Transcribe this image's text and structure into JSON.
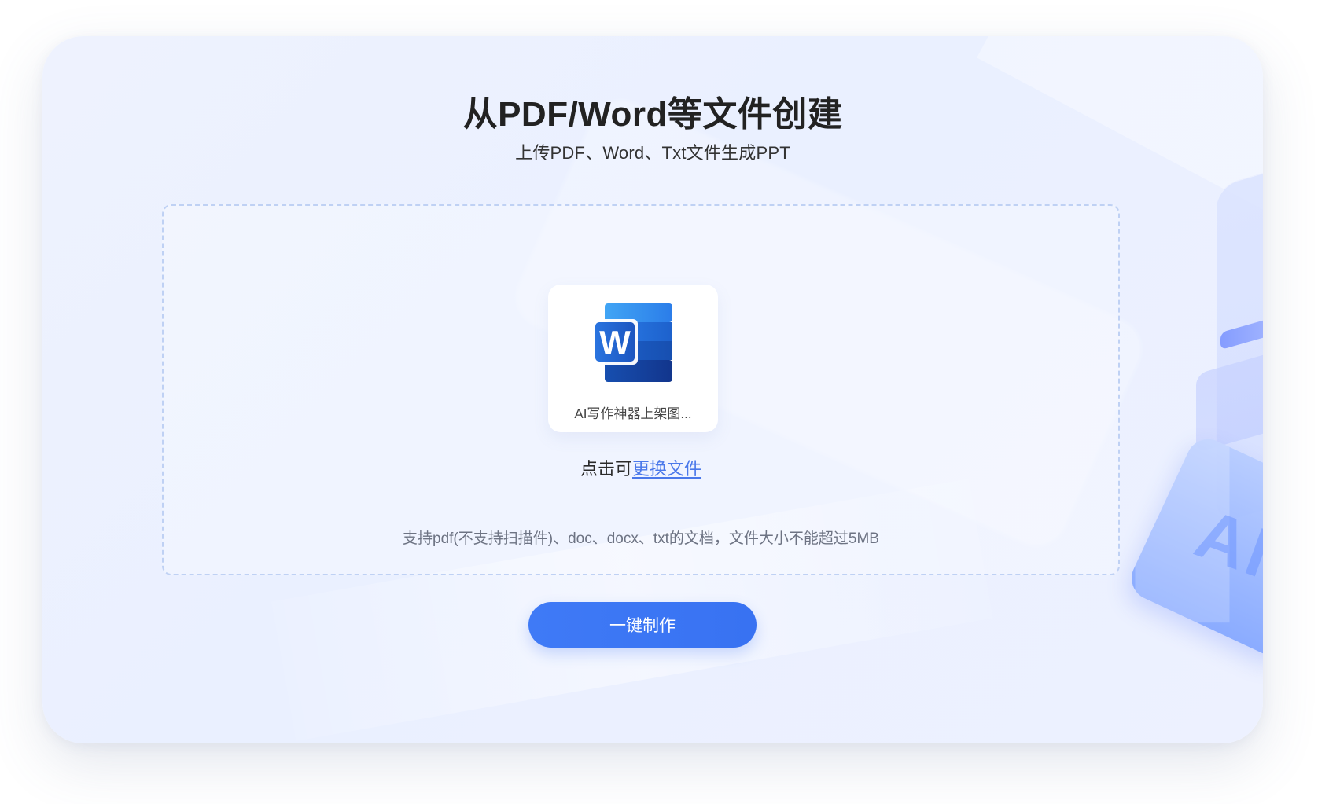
{
  "header": {
    "title": "从PDF/Word等文件创建",
    "subtitle": "上传PDF、Word、Txt文件生成PPT"
  },
  "upload": {
    "file_name": "AI写作神器上架图...",
    "change_prefix": "点击可",
    "change_link": "更换文件",
    "support_text": "支持pdf(不支持扫描件)、doc、docx、txt的文档，文件大小不能超过5MB"
  },
  "actions": {
    "primary_button": "一键制作"
  },
  "icons": {
    "file_type": "word-file-icon",
    "decorative_badge": "ai-badge-icon"
  },
  "colors": {
    "primary": "#3a74f4",
    "link": "#4a78ea",
    "background": "#edf1ff",
    "title_text": "#222222"
  },
  "decoration": {
    "ai_text": "AI"
  }
}
